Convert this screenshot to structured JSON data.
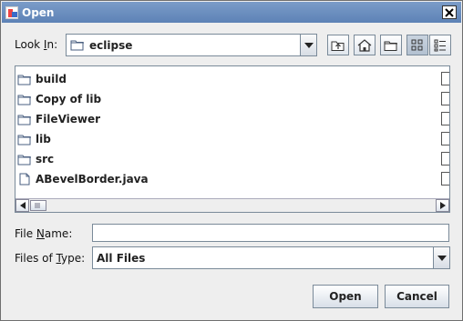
{
  "window": {
    "title": "Open"
  },
  "look_in": {
    "label_pre": "Look ",
    "label_mnemonic": "I",
    "label_post": "n:",
    "value": "eclipse",
    "icon": "folder-icon"
  },
  "toolbar": {
    "buttons": [
      {
        "name": "up-one-level-button",
        "icon": "folder-up-icon"
      },
      {
        "name": "home-button",
        "icon": "home-icon"
      },
      {
        "name": "new-folder-button",
        "icon": "new-folder-icon"
      },
      {
        "name": "list-view-button",
        "icon": "list-view-icon"
      },
      {
        "name": "details-view-button",
        "icon": "details-view-icon"
      }
    ]
  },
  "files": [
    {
      "name": "build",
      "type": "folder"
    },
    {
      "name": "Copy of lib",
      "type": "folder"
    },
    {
      "name": "FileViewer",
      "type": "folder"
    },
    {
      "name": "lib",
      "type": "folder"
    },
    {
      "name": "src",
      "type": "folder"
    },
    {
      "name": "ABevelBorder.java",
      "type": "file"
    }
  ],
  "file_name": {
    "label_pre": "File ",
    "label_mnemonic": "N",
    "label_post": "ame:",
    "value": ""
  },
  "files_of_type": {
    "label_pre": "Files of ",
    "label_mnemonic": "T",
    "label_post": "ype:",
    "value": "All Files"
  },
  "actions": {
    "open_label": "Open",
    "cancel_label": "Cancel"
  }
}
